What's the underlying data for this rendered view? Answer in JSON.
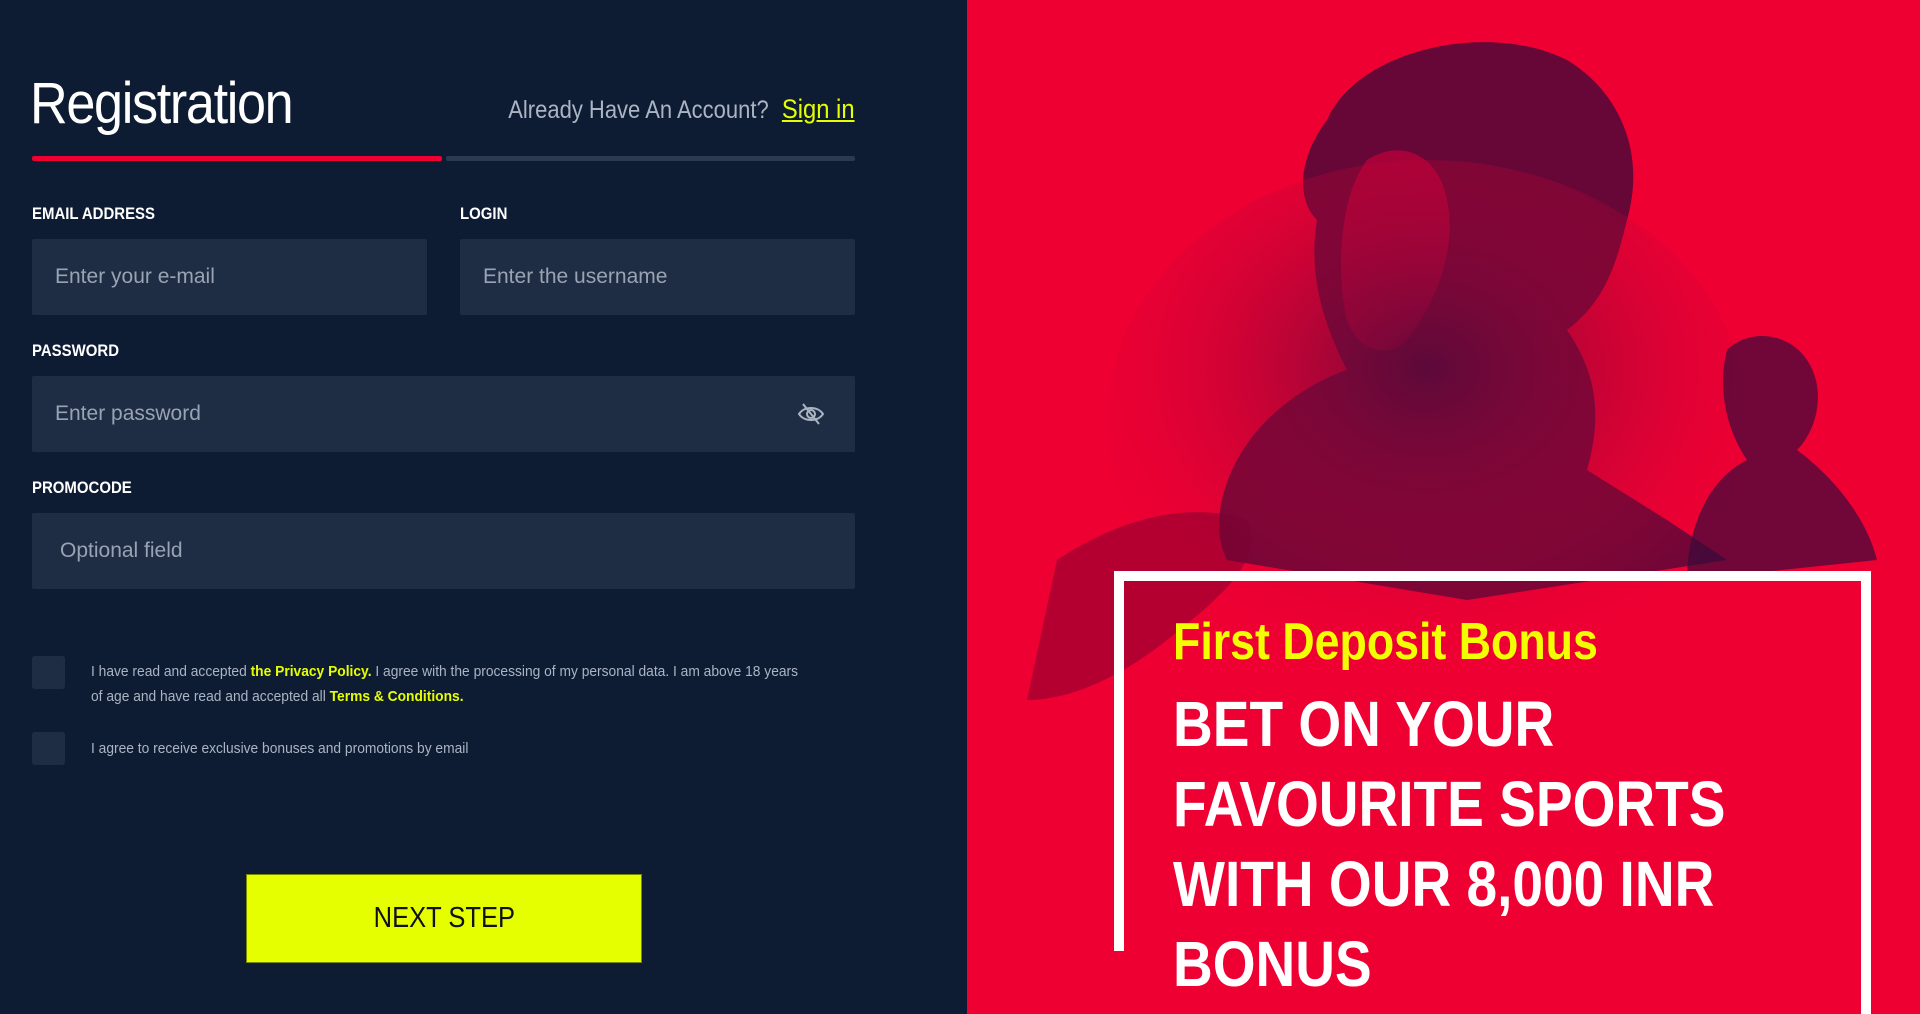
{
  "registration": {
    "title": "Registration",
    "already_have_account": "Already Have An Account?",
    "sign_in_label": "Sign in",
    "progress": {
      "current_step": 1,
      "total_steps": 2
    },
    "fields": {
      "email": {
        "label": "EMAIL ADDRESS",
        "placeholder": "Enter your e-mail",
        "value": ""
      },
      "login": {
        "label": "LOGIN",
        "placeholder": "Enter the username",
        "value": ""
      },
      "password": {
        "label": "PASSWORD",
        "placeholder": "Enter password",
        "value": "",
        "toggle_icon": "eye-off-icon"
      },
      "promocode": {
        "label": "PROMOCODE",
        "placeholder": "Optional field",
        "value": ""
      }
    },
    "consents": [
      {
        "checked": false,
        "text_before": "I have read and accepted ",
        "link1": "the Privacy Policy.",
        "text_middle": " I agree with the processing of my personal data. I am above 18 years of age and have read and accepted all ",
        "link2": "Terms & Conditions."
      },
      {
        "checked": false,
        "text": "I agree to receive exclusive bonuses and promotions by email"
      }
    ],
    "next_button_label": "NEXT STEP"
  },
  "promo": {
    "subtitle": "First Deposit Bonus",
    "headline_lines": [
      "BET ON YOUR",
      "FAVOURITE SPORTS",
      "WITH OUR 8,000 INR",
      "BONUS"
    ]
  },
  "colors": {
    "background": "#0e1c33",
    "input_bg": "#1f2d44",
    "accent_yellow": "#e6ff00",
    "accent_red": "#ee0033"
  }
}
